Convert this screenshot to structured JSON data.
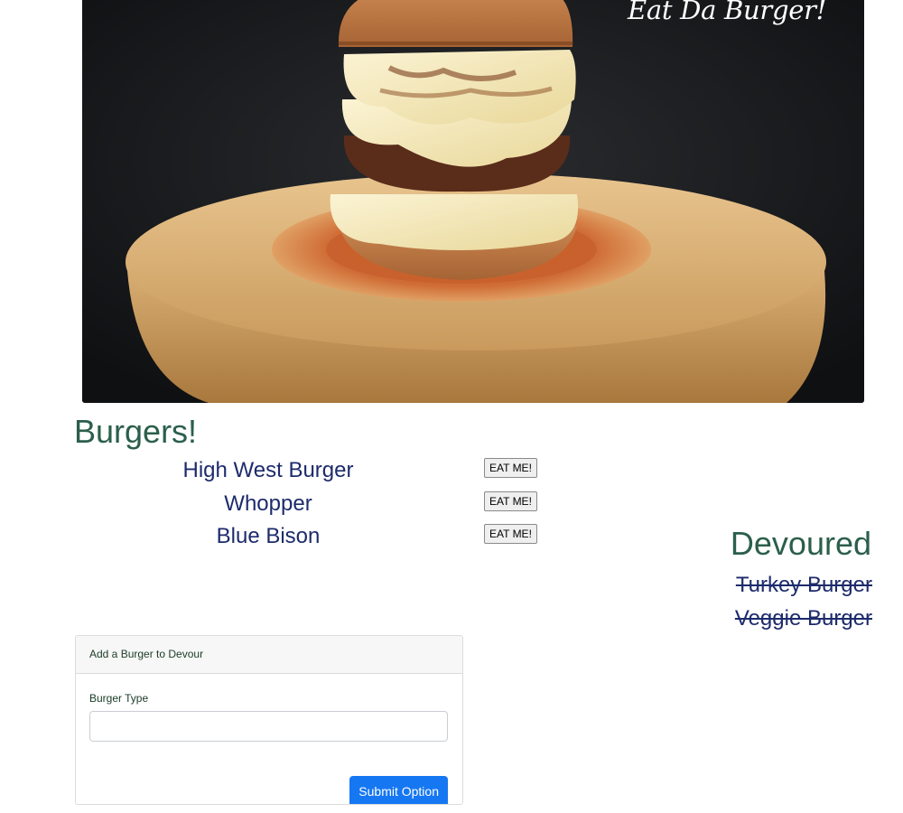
{
  "hero": {
    "title": "Eat Da Burger!",
    "image_icon": "burger-photo"
  },
  "burgers": {
    "heading": "Burgers!",
    "items": [
      {
        "name": "High West Burger",
        "button_label": "EAT ME!"
      },
      {
        "name": "Whopper",
        "button_label": "EAT ME!"
      },
      {
        "name": "Blue Bison",
        "button_label": "EAT ME!"
      }
    ]
  },
  "devoured": {
    "heading": "Devoured",
    "items": [
      "Turkey Burger",
      "Veggie Burger"
    ]
  },
  "form": {
    "header": "Add a Burger to Devour",
    "field_label": "Burger Type",
    "field_value": "",
    "field_placeholder": "",
    "submit_label": "Submit Option"
  },
  "colors": {
    "heading": "#2b5f4b",
    "item_text": "#1d2b6b",
    "submit_bg": "#1677f2"
  }
}
